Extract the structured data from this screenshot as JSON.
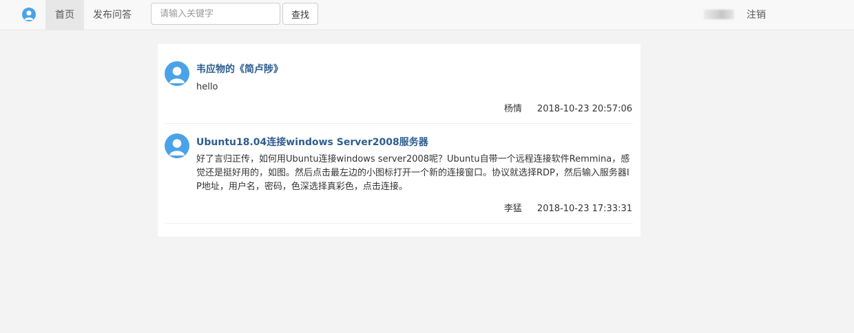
{
  "nav": {
    "home_label": "首页",
    "ask_label": "发布问答",
    "search_placeholder": "请输入关键字",
    "search_button": "查找",
    "logout_label": "注销"
  },
  "posts": [
    {
      "title": "韦应物的《简卢陟》",
      "content": "hello",
      "author": "杨情",
      "time": "2018-10-23 20:57:06"
    },
    {
      "title": "Ubuntu18.04连接windows Server2008服务器",
      "content": "好了言归正传，如何用Ubuntu连接windows server2008呢？Ubuntu自带一个远程连接软件Remmina，感觉还是挺好用的，如图。然后点击最左边的小图标打开一个新的连接窗口。协议就选择RDP，然后输入服务器IP地址，用户名，密码，色深选择真彩色，点击连接。",
      "author": "李猛",
      "time": "2018-10-23 17:33:31"
    }
  ],
  "colors": {
    "accent": "#4aa3e8",
    "title": "#2d5d8f",
    "navbar_bg": "#f8f8f8",
    "page_bg": "#f3f3f3"
  },
  "icons": {
    "logo": "user-avatar-icon",
    "post_avatar": "user-avatar-icon"
  }
}
